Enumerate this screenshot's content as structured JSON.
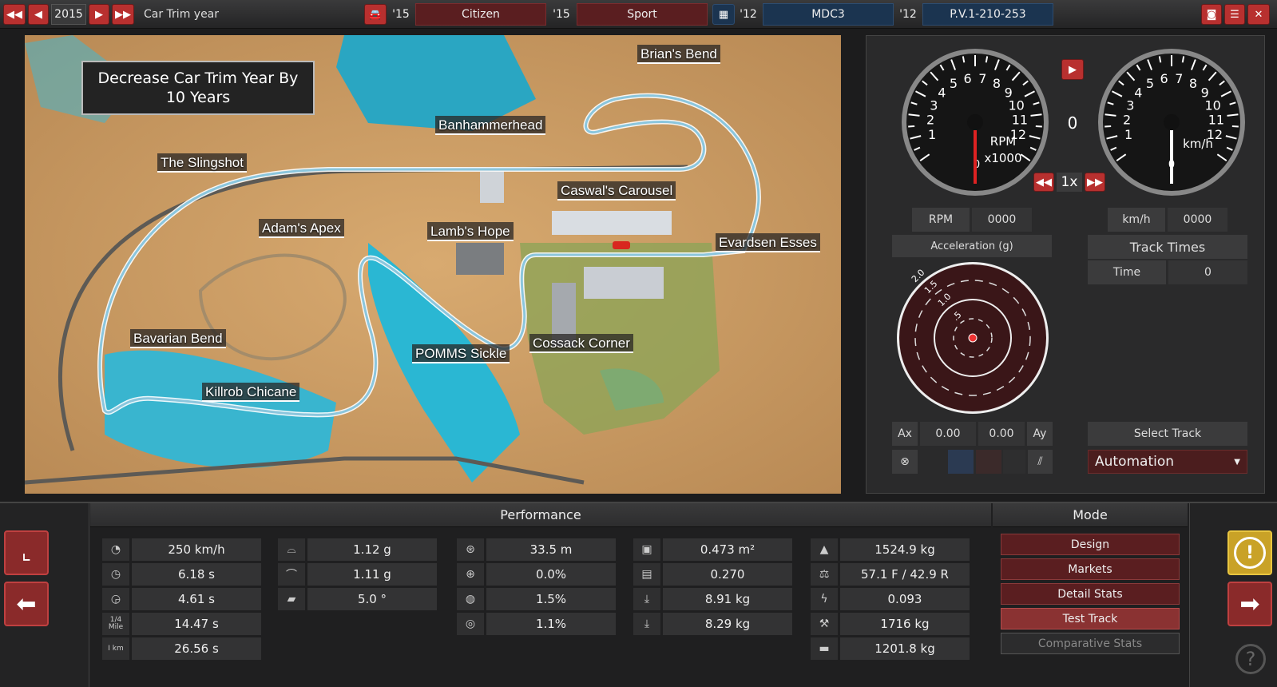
{
  "topbar": {
    "year": "2015",
    "trim_label": "Car Trim year",
    "car1_year": "'15",
    "car1_name": "Citizen",
    "trim1_year": "'15",
    "trim1_name": "Sport",
    "engine_year": "'12",
    "engine_name": "MDC3",
    "variant_year": "'12",
    "variant_name": "P.V.1-210-253"
  },
  "tooltip": "Decrease Car Trim Year By 10 Years",
  "track_labels": [
    "Brian's Bend",
    "Banhammerhead",
    "The Slingshot",
    "Caswal's Carousel",
    "Adam's Apex",
    "Lamb's Hope",
    "Evardsen Esses",
    "Bavarian Bend",
    "POMMS Sickle",
    "Cossack Corner",
    "Killrob Chicane"
  ],
  "gauges": {
    "rpm_ticks": [
      "1",
      "2",
      "3",
      "4",
      "5",
      "6",
      "7",
      "8",
      "9",
      "10",
      "11",
      "12"
    ],
    "rpm_label": "RPM",
    "rpm_unit": "x1000",
    "rpm_zero": "0",
    "speed_ticks": [
      "1",
      "2",
      "3",
      "4",
      "5",
      "6",
      "7",
      "8",
      "9",
      "10",
      "11",
      "12"
    ],
    "speed_unit": "km/h",
    "speed_zero": "0",
    "gear": "0",
    "speed_mult": "1x"
  },
  "readouts": {
    "rpm_label": "RPM",
    "rpm_value": "0000",
    "kmh_label": "km/h",
    "kmh_value": "0000"
  },
  "accel": {
    "title": "Acceleration (g)",
    "ring_labels": [
      "2.0",
      "1.5",
      "1.0",
      ".5"
    ],
    "ax_label": "Ax",
    "ax_value": "0.00",
    "ay_value": "0.00",
    "ay_label": "Ay"
  },
  "track_times": {
    "title": "Track Times",
    "time_label": "Time",
    "time_value": "0",
    "select_label": "Select Track",
    "selected_track": "Automation"
  },
  "performance": {
    "title": "Performance",
    "col1": [
      {
        "icon": "speedometer-icon",
        "value": "250 km/h"
      },
      {
        "icon": "stopwatch-60-icon",
        "value": "6.18 s"
      },
      {
        "icon": "stopwatch-100-icon",
        "value": "4.61 s"
      },
      {
        "icon": "quarter-mile-icon",
        "label": "1/4 Mile",
        "value": "14.47 s"
      },
      {
        "icon": "kilometer-icon",
        "label": "I km",
        "value": "26.56 s"
      }
    ],
    "col2": [
      {
        "icon": "cornering-icon",
        "value": "1.12 g"
      },
      {
        "icon": "cornering-alt-icon",
        "value": "1.11 g"
      },
      {
        "icon": "car-tilt-icon",
        "value": "5.0 °"
      }
    ],
    "col3": [
      {
        "icon": "turning-circle-icon",
        "value": "33.5 m"
      },
      {
        "icon": "steering-icon",
        "value": "0.0%"
      },
      {
        "icon": "tire-icon",
        "value": "1.5%"
      },
      {
        "icon": "tire-wear-icon",
        "value": "1.1%"
      }
    ],
    "col4": [
      {
        "icon": "frontal-area-icon",
        "value": "0.473 m²"
      },
      {
        "icon": "drag-icon",
        "value": "0.270"
      },
      {
        "icon": "front-downforce-icon",
        "value": "8.91 kg"
      },
      {
        "icon": "rear-downforce-icon",
        "value": "8.29 kg"
      }
    ],
    "col5": [
      {
        "icon": "weight-icon",
        "value": "1524.9 kg"
      },
      {
        "icon": "weight-distribution-icon",
        "value": "57.1 F / 42.9 R"
      },
      {
        "icon": "lightning-icon",
        "value": "0.093"
      },
      {
        "icon": "towing-icon",
        "value": "1716 kg"
      },
      {
        "icon": "payload-icon",
        "value": "1201.8 kg"
      }
    ]
  },
  "mode": {
    "title": "Mode",
    "buttons": [
      "Design",
      "Markets",
      "Detail Stats",
      "Test Track",
      "Comparative Stats"
    ]
  },
  "colors": {
    "accent_red": "#b8302f",
    "maroon": "#5a1e20",
    "navy": "#1b3450",
    "warning_yellow": "#c9a227"
  }
}
